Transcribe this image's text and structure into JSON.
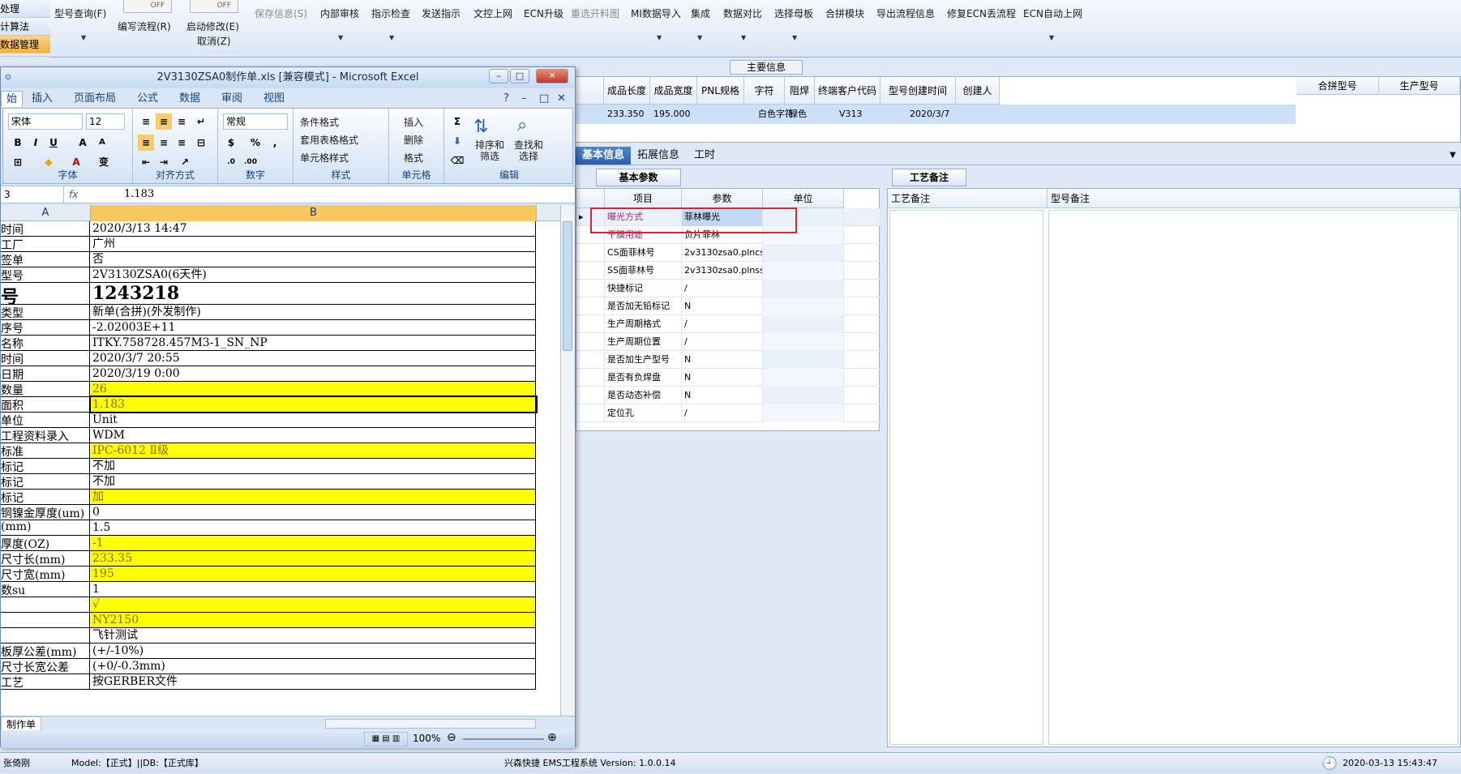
{
  "nav": {
    "items": [
      "处理",
      "计算法",
      "数据管理",
      "Z"
    ]
  },
  "toolbar": {
    "toggle1": "OFF",
    "toggle2": "OFF",
    "buttons": [
      {
        "label": "型号查询(F)",
        "disabled": false
      },
      {
        "label": "编写流程(R)",
        "disabled": false
      },
      {
        "label": "启动修改(E)",
        "disabled": false
      },
      {
        "label": "保存信息(S)",
        "disabled": true
      },
      {
        "label": "内部审核",
        "disabled": false
      },
      {
        "label": "指示检查",
        "disabled": false
      },
      {
        "label": "发送指示",
        "disabled": false
      },
      {
        "label": "文控上网",
        "disabled": false
      },
      {
        "label": "ECN升级",
        "disabled": false
      },
      {
        "label": "重选开料图",
        "disabled": true
      },
      {
        "label": "MI数据导入",
        "disabled": false
      },
      {
        "label": "集成",
        "disabled": false
      },
      {
        "label": "数据对比",
        "disabled": false
      },
      {
        "label": "选择母板",
        "disabled": false
      },
      {
        "label": "合拼模块",
        "disabled": false
      },
      {
        "label": "导出流程信息",
        "disabled": false
      },
      {
        "label": "修复ECN丢流程",
        "disabled": false
      },
      {
        "label": "ECN自动上网",
        "disabled": false
      }
    ],
    "cancel_label": "取消(Z)"
  },
  "main_info": {
    "title": "主要信息",
    "headers": [
      "成品长度",
      "成品宽度",
      "PNL规格",
      "字符",
      "阻焊",
      "终端客户代码",
      "型号创建时间",
      "创建人"
    ],
    "row": [
      "233.350",
      "195.000",
      "",
      "白色字符",
      "绿色",
      "V313",
      "2020/3/7",
      ""
    ],
    "right_headers": [
      "合拼型号",
      "生产型号"
    ]
  },
  "tabs": [
    "基本信息",
    "拓展信息",
    "工时"
  ],
  "basic_params": {
    "tab": "基本参数",
    "headers": [
      "项目",
      "参数",
      "单位"
    ],
    "rows": [
      {
        "item": "曝光方式",
        "value": "菲林曝光",
        "colored": true
      },
      {
        "item": "干膜用途",
        "value": "负片菲林",
        "colored": true
      },
      {
        "item": "CS面菲林号",
        "value": "2v3130zsa0.plncs",
        "colored": false
      },
      {
        "item": "SS面菲林号",
        "value": "2v3130zsa0.plnss",
        "colored": false
      },
      {
        "item": "快捷标记",
        "value": "/",
        "colored": false
      },
      {
        "item": "是否加无铅标记",
        "value": "N",
        "colored": false
      },
      {
        "item": "生产周期格式",
        "value": "/",
        "colored": false
      },
      {
        "item": "生产周期位置",
        "value": "/",
        "colored": false
      },
      {
        "item": "是否加生产型号",
        "value": "N",
        "colored": false
      },
      {
        "item": "是否有负焊盘",
        "value": "N",
        "colored": false
      },
      {
        "item": "是否动态补偿",
        "value": "N",
        "colored": false
      },
      {
        "item": "定位孔",
        "value": "/",
        "colored": false
      }
    ]
  },
  "process_notes": {
    "tab": "工艺备注",
    "col1": "工艺备注",
    "col2": "型号备注"
  },
  "statusbar": {
    "user": "张倚刚",
    "model": "Model:【正式】||DB:【正式库】",
    "system": "兴森快捷 EMS工程系统 Version: 1.0.0.14",
    "datetime": "2020-03-13 15:43:47"
  },
  "excel": {
    "title": "2V3130ZSA0制作单.xls [兼容模式] - Microsoft Excel",
    "tabs": [
      "始",
      "插入",
      "页面布局",
      "公式",
      "数据",
      "审阅",
      "视图"
    ],
    "ribbon": {
      "font_name": "宋体",
      "font_size": "12",
      "number_format": "常规",
      "groups": [
        "字体",
        "对齐方式",
        "数字",
        "样式",
        "单元格",
        "编辑"
      ],
      "styles": [
        "条件格式",
        "套用表格格式",
        "单元格样式"
      ],
      "cells": [
        "插入",
        "删除",
        "格式"
      ],
      "edit": [
        "排序和筛选",
        "查找和选择"
      ]
    },
    "name_box": "3",
    "formula": "1.183",
    "columns": [
      "A",
      "B"
    ],
    "rows": [
      {
        "a": "时间",
        "b": "2020/3/13 14:47",
        "y": false,
        "big": false
      },
      {
        "a": "工厂",
        "b": "广州",
        "y": false,
        "big": false
      },
      {
        "a": "签单",
        "b": "否",
        "y": false,
        "big": false
      },
      {
        "a": "型号",
        "b": "2V3130ZSA0(6天件)",
        "y": false,
        "big": false
      },
      {
        "a": "号",
        "b": "1243218",
        "y": false,
        "big": true
      },
      {
        "a": "类型",
        "b": "新单(合拼)(外发制作)",
        "y": false,
        "big": false
      },
      {
        "a": "序号",
        "b": "-2.02003E+11",
        "y": false,
        "big": false
      },
      {
        "a": "名称",
        "b": "ITKY.758728.457M3-1_SN_NP",
        "y": false,
        "big": false
      },
      {
        "a": "时间",
        "b": "2020/3/7 20:55",
        "y": false,
        "big": false
      },
      {
        "a": "日期",
        "b": "2020/3/19 0:00",
        "y": false,
        "big": false
      },
      {
        "a": "数量",
        "b": "26",
        "y": true,
        "big": false
      },
      {
        "a": "面积",
        "b": "1.183",
        "y": true,
        "big": false
      },
      {
        "a": "单位",
        "b": "Unit",
        "y": false,
        "big": false
      },
      {
        "a": "工程资料录入",
        "b": "WDM",
        "y": false,
        "big": false
      },
      {
        "a": "标准",
        "b": "IPC-6012 Ⅱ级",
        "y": true,
        "big": false
      },
      {
        "a": "标记",
        "b": "不加",
        "y": false,
        "big": false
      },
      {
        "a": "标记",
        "b": "不加",
        "y": false,
        "big": false
      },
      {
        "a": "标记",
        "b": "加",
        "y": true,
        "big": false
      },
      {
        "a": "铜镍金厚度(um)",
        "b": "0",
        "y": false,
        "big": false
      },
      {
        "a": "(mm)",
        "b": "1.5",
        "y": false,
        "big": false
      },
      {
        "a": "厚度(OZ)",
        "b": "-1",
        "y": true,
        "big": false
      },
      {
        "a": "尺寸长(mm)",
        "b": "233.35",
        "y": true,
        "big": false
      },
      {
        "a": "尺寸宽(mm)",
        "b": "195",
        "y": true,
        "big": false
      },
      {
        "a": "数su",
        "b": "1",
        "y": false,
        "big": false
      },
      {
        "a": "",
        "b": "√",
        "y": true,
        "big": false
      },
      {
        "a": "",
        "b": "NY2150",
        "y": true,
        "big": false
      },
      {
        "a": "",
        "b": "飞针测试",
        "y": false,
        "big": false
      },
      {
        "a": "板厚公差(mm)",
        "b": "(+/-10%)",
        "y": false,
        "big": false
      },
      {
        "a": "尺寸长宽公差",
        "b": "(+0/-0.3mm)",
        "y": false,
        "big": false
      },
      {
        "a": "工艺",
        "b": "按GERBER文件",
        "y": false,
        "big": false
      }
    ],
    "sheet_tab": "制作单",
    "zoom": "100%"
  }
}
